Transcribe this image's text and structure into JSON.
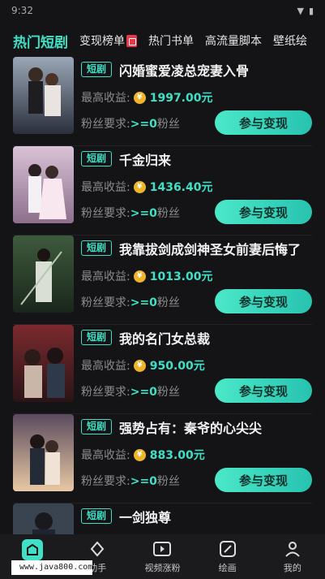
{
  "status_bar": {
    "time": "9:32"
  },
  "tabs": [
    {
      "label": "热门短剧",
      "active": true
    },
    {
      "label": "变现榜单",
      "active": false,
      "badge": "hot-icon"
    },
    {
      "label": "热门书单",
      "active": false
    },
    {
      "label": "高流量脚本",
      "active": false
    },
    {
      "label": "壁纸绘",
      "active": false
    }
  ],
  "common": {
    "tag": "短剧",
    "earn_label": "最高收益:",
    "coin_symbol": "¥",
    "fans_label": "粉丝要求:",
    "fans_req": ">=0",
    "fans_unit": "粉丝",
    "join_label": "参与变现"
  },
  "items": [
    {
      "title": "闪婚蜜爱凌总宠妻入骨",
      "earn": "1997.00元",
      "poster_text": "闪婚蜜爱凌总宠妻入骨"
    },
    {
      "title": "千金归来",
      "earn": "1436.40元",
      "poster_text": "千金归来"
    },
    {
      "title": "我靠拔剑成剑神圣女前妻后悔了",
      "earn": "1013.00元",
      "poster_text": ""
    },
    {
      "title": "我的名门女总裁",
      "earn": "950.00元",
      "poster_text": "我的名门女总裁"
    },
    {
      "title": "强势占有：秦爷的心尖尖",
      "earn": "883.00元",
      "poster_text": "秦爷的心尖尖"
    },
    {
      "title": "一剑独尊",
      "earn": "",
      "poster_text": ""
    }
  ],
  "bottom_nav": [
    {
      "label": "",
      "icon": "home-icon",
      "active": true
    },
    {
      "label": "助手",
      "icon": "assistant-icon",
      "active": false
    },
    {
      "label": "视频涨粉",
      "icon": "video-icon",
      "active": false
    },
    {
      "label": "绘画",
      "icon": "paint-icon",
      "active": false
    },
    {
      "label": "我的",
      "icon": "profile-icon",
      "active": false
    }
  ],
  "watermark": "www.java800.com",
  "colors": {
    "accent": "#3fe0c6",
    "background": "#141416",
    "coin": "#f0b429"
  }
}
